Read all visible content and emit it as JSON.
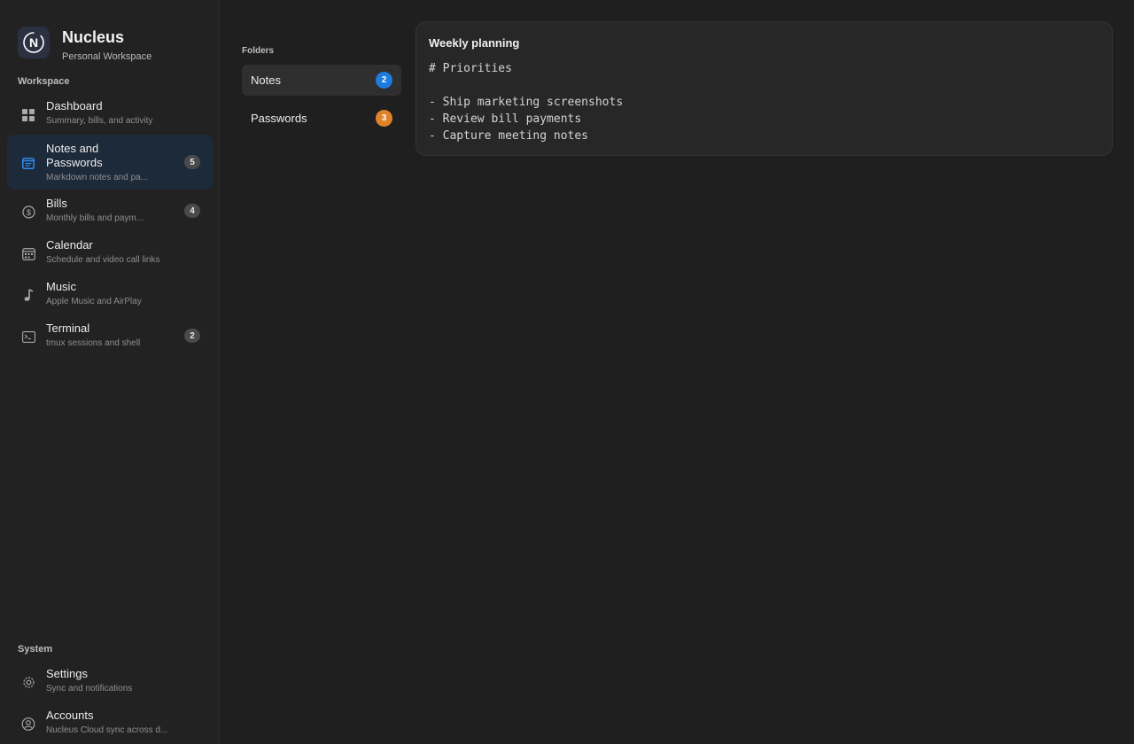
{
  "brand": {
    "name": "Nucleus",
    "subtitle": "Personal Workspace",
    "logo_letter": "N"
  },
  "sidebar": {
    "workspace_label": "Workspace",
    "system_label": "System",
    "items": [
      {
        "title": "Dashboard",
        "desc": "Summary, bills, and activity",
        "badge": null,
        "icon": "dashboard-grid-icon"
      },
      {
        "title": "Notes and Passwords",
        "desc": "Markdown notes and pa...",
        "badge": "5",
        "icon": "notes-icon"
      },
      {
        "title": "Bills",
        "desc": "Monthly bills and paym...",
        "badge": "4",
        "icon": "dollar-circle-icon"
      },
      {
        "title": "Calendar",
        "desc": "Schedule and video call links",
        "badge": null,
        "icon": "calendar-icon"
      },
      {
        "title": "Music",
        "desc": "Apple Music and AirPlay",
        "badge": null,
        "icon": "music-note-icon"
      },
      {
        "title": "Terminal",
        "desc": "tmux sessions and shell",
        "badge": "2",
        "icon": "terminal-icon"
      }
    ],
    "system_items": [
      {
        "title": "Settings",
        "desc": "Sync and notifications",
        "icon": "gear-icon"
      },
      {
        "title": "Accounts",
        "desc": "Nucleus Cloud sync across d...",
        "icon": "accounts-icon"
      }
    ]
  },
  "folders": {
    "label": "Folders",
    "items": [
      {
        "name": "Notes",
        "count": "2",
        "color": "#1e7be0"
      },
      {
        "name": "Passwords",
        "count": "3",
        "color": "#e0822a"
      }
    ]
  },
  "note": {
    "title": "Weekly planning",
    "body": "# Priorities\n\n- Ship marketing screenshots\n- Review bill payments\n- Capture meeting notes"
  },
  "colors": {
    "accent": "#1e7be0",
    "active_bg": "#1d2a3a",
    "passwords_badge": "#e0822a"
  }
}
